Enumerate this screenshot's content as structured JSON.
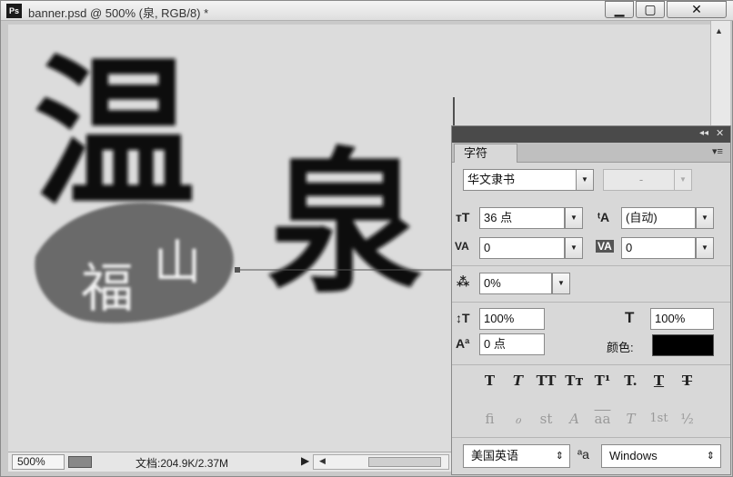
{
  "window": {
    "title": "banner.psd @ 500% (泉, RGB/8) *",
    "app_icon": "Ps",
    "min_glyph": "▁",
    "max_glyph": "▢",
    "close_glyph": "✕"
  },
  "artwork": {
    "char_1": "温",
    "char_2": "泉",
    "badge_char_1": "山",
    "badge_char_2": "福"
  },
  "statusbar": {
    "zoom": "500%",
    "doc_info": "文档:204.9K/2.37M",
    "arrow": "▶",
    "scroll_left": "◀"
  },
  "panel": {
    "tab_label": "字符",
    "collapse_glyph": "◂◂",
    "close_glyph": "✕",
    "menu_glyph": "▾≡",
    "font_family": "华文隶书",
    "font_style": "-",
    "font_size": "36 点",
    "leading": "(自动)",
    "kerning": "0",
    "tracking": "0",
    "scale_tsume": "0%",
    "vertical_scale": "100%",
    "horizontal_scale": "100%",
    "baseline_shift": "0 点",
    "color_label": "颜色:",
    "color_value": "#000000",
    "style_buttons": [
      "T",
      "T",
      "TT",
      "Tт",
      "T¹",
      "T.",
      "T",
      "T"
    ],
    "opentype_buttons": [
      "fi",
      "ℴ",
      "st",
      "A",
      "aa",
      "T",
      "1st",
      "½"
    ],
    "language": "美国英语",
    "antialias": "Windows",
    "aa_label": "ªa",
    "dropdown_glyph": "▼",
    "updown_glyph": "⇕"
  },
  "colors": {
    "panel_bg": "#d8d8d8",
    "canvas_bg": "#dcdcdc",
    "ink": "#111111",
    "leaf": "#6a6a6a"
  }
}
